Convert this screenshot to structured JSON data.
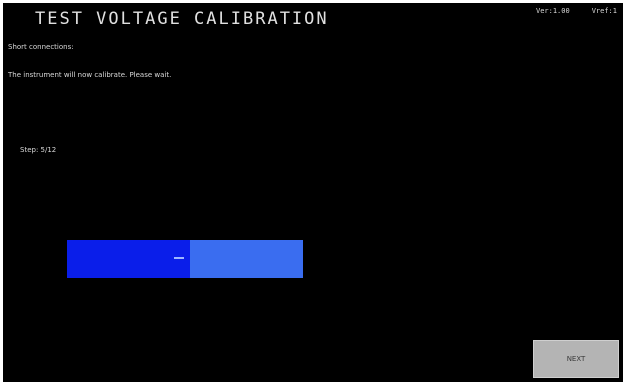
{
  "header": {
    "title": "TEST VOLTAGE CALIBRATION",
    "status_left": "Ver:1.00",
    "status_right": "Vref:1"
  },
  "messages": {
    "line1": "Short connections:",
    "line2": "The instrument will now calibrate. Please wait."
  },
  "step": {
    "label": "Step: 5/12"
  },
  "progress": {
    "fraction": 0.52,
    "fill_color": "#0a1eea",
    "track_color": "#3a6df0"
  },
  "buttons": {
    "next_label": "NEXT"
  }
}
